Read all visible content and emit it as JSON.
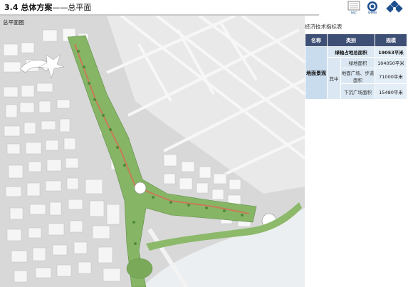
{
  "header": {
    "section": "3.4 总体方案",
    "subtitle": "——总平面",
    "logo_nsc": "NSC",
    "logo_shmei": "SHMEI"
  },
  "map": {
    "label": "总平面图",
    "colors": {
      "background": "#dcdcdc",
      "roads": "#f4f4f4",
      "buildings": "#ffffff",
      "green": "#7fae5c",
      "water": "#e8eef1",
      "plaza_path": "#c97a5a"
    }
  },
  "table": {
    "title": "经济技术指标表",
    "headers": [
      "名称",
      "类别",
      "规模"
    ],
    "category": "地面景观",
    "rows": [
      {
        "label": "绿轴占地总面积",
        "value": "19053平米"
      },
      {
        "label": "绿地面积",
        "value": "104050平米"
      },
      {
        "label": "地面广场、步道面积",
        "value": "71000平米"
      },
      {
        "label": "下沉广场面积",
        "value": "15480平米"
      }
    ],
    "sub_group": "其中",
    "colors": {
      "header_bg": "#3d4f74",
      "cell_bg": "#e4eef7",
      "category_bg": "#c9dcee"
    }
  }
}
